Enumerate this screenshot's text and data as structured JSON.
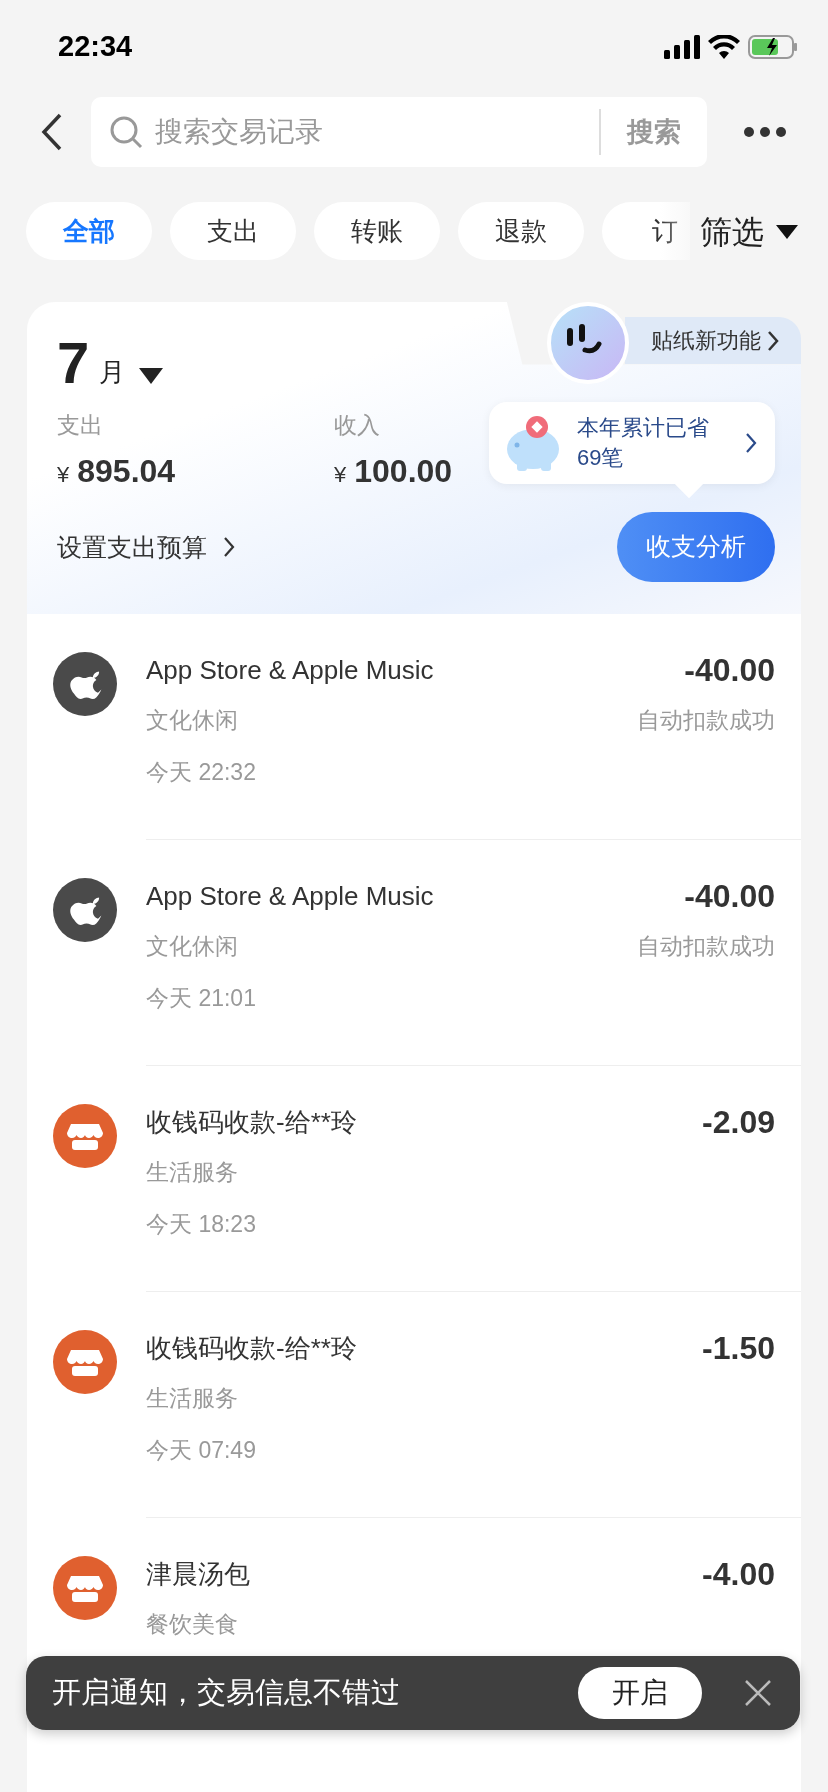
{
  "status_bar": {
    "time": "22:34"
  },
  "search": {
    "placeholder": "搜索交易记录",
    "button": "搜索"
  },
  "chips": [
    {
      "label": "全部",
      "selected": true
    },
    {
      "label": "支出",
      "selected": false
    },
    {
      "label": "转账",
      "selected": false
    },
    {
      "label": "退款",
      "selected": false
    },
    {
      "label": "订",
      "selected": false
    }
  ],
  "filter": "筛选",
  "summary": {
    "month": "7",
    "month_unit": "月",
    "expense_label": "支出",
    "currency": "¥",
    "expense": "895.04",
    "income_label": "收入",
    "income": "100.00",
    "budget_link": "设置支出预算",
    "sticker": "贴纸新功能",
    "savings_title": "本年累计已省",
    "savings_count": "69笔",
    "analysis_button": "收支分析"
  },
  "transactions": [
    {
      "kind": "apple",
      "title": "App Store & Apple Music",
      "category": "文化休闲",
      "time": "今天 22:32",
      "amount": "-40.00",
      "status": "自动扣款成功"
    },
    {
      "kind": "apple",
      "title": "App Store & Apple Music",
      "category": "文化休闲",
      "time": "今天 21:01",
      "amount": "-40.00",
      "status": "自动扣款成功"
    },
    {
      "kind": "shop",
      "title": "收钱码收款-给**玲",
      "category": "生活服务",
      "time": "今天 18:23",
      "amount": "-2.09"
    },
    {
      "kind": "shop",
      "title": "收钱码收款-给**玲",
      "category": "生活服务",
      "time": "今天 07:49",
      "amount": "-1.50"
    },
    {
      "kind": "shop",
      "title": "津晨汤包",
      "category": "餐饮美食",
      "amount": "-4.00"
    }
  ],
  "toast": {
    "message": "开启通知，交易信息不错过",
    "button": "开启"
  }
}
